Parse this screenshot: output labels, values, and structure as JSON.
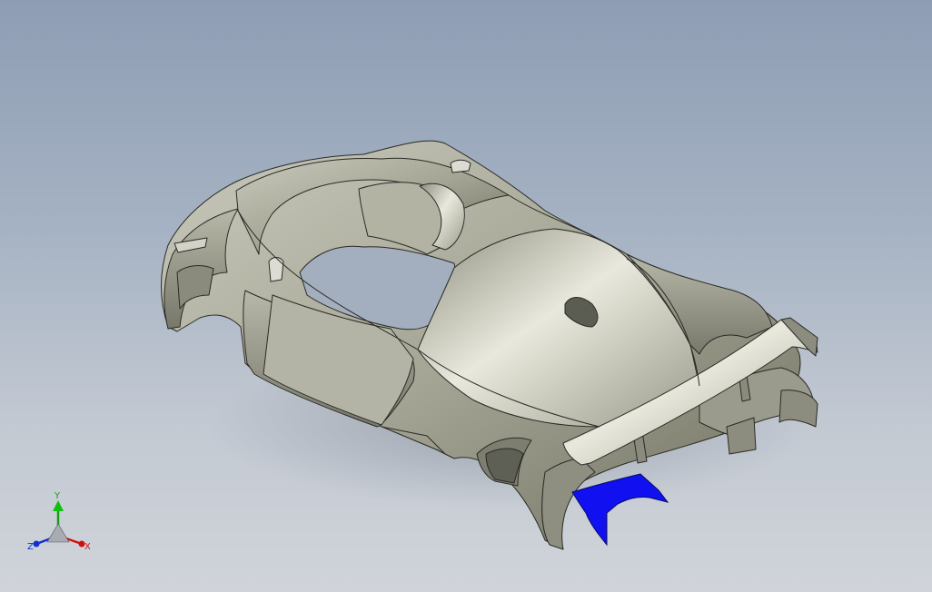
{
  "viewport": {
    "background_top": "#8e9db4",
    "background_bottom": "#d0d4da"
  },
  "model": {
    "body_color": "#a9aa9b",
    "edge_color": "#2a2a26",
    "selected_face_color": "#1010f0"
  },
  "triad": {
    "x_label": "X",
    "y_label": "Y",
    "z_label": "Z",
    "x_color": "#d01010",
    "y_color": "#10a010",
    "z_color": "#1030d0"
  }
}
